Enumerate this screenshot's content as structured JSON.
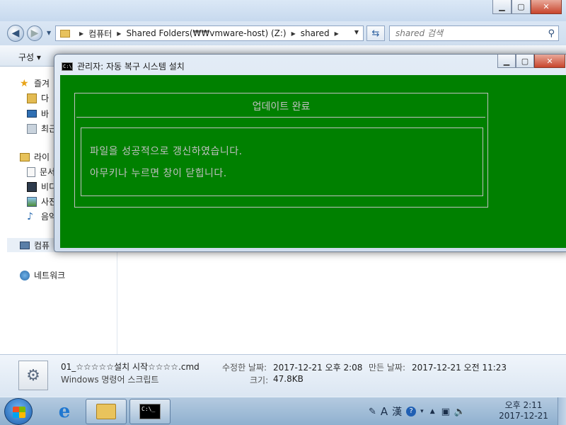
{
  "explorer": {
    "caption_buttons": {
      "minimize": "▁",
      "maximize": "▢",
      "close": "✕"
    },
    "breadcrumb": [
      "컴퓨터",
      "Shared Folders(₩₩vmware-host) (Z:)",
      "shared"
    ],
    "search_placeholder": "shared 검색",
    "organize_label": "구성 ▾",
    "nav": {
      "favorites": "즐겨",
      "downloads": "다",
      "desktop": "바",
      "recent": "최근",
      "libraries": "라이",
      "documents": "문서",
      "videos": "비디",
      "pictures": "사진",
      "music": "음악",
      "computer": "컴퓨",
      "network": "네트워크"
    },
    "details": {
      "filename": "01_☆☆☆☆☆설치 시작☆☆☆☆.cmd",
      "filetype": "Windows 명령어 스크립트",
      "modified_label": "수정한 날짜:",
      "modified_value": "2017-12-21 오후 2:08",
      "created_label": "만든 날짜:",
      "created_value": "2017-12-21 오전 11:23",
      "size_label": "크기:",
      "size_value": "47.8KB"
    }
  },
  "cmd_window": {
    "title": "관리자:  자동 복구 시스템 설치",
    "icon_text": "C:\\",
    "box_title": "업데이트 완료",
    "line1": "파일을 성공적으로 갱신하였습니다.",
    "line2": "아무키나 누르면 창이 닫힙니다.",
    "console_bg": "#008000",
    "console_fg": "#c0c0c0"
  },
  "taskbar": {
    "tray_lang": "A",
    "tray_hanja": "漢",
    "clock_time": "오후 2:11",
    "clock_date": "2017-12-21"
  }
}
